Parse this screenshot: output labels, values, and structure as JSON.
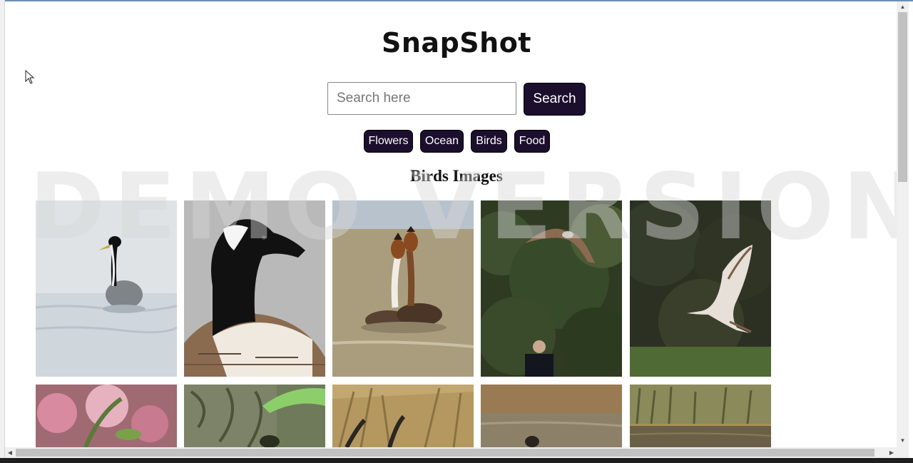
{
  "app": {
    "title": "SnapShot"
  },
  "search": {
    "placeholder": "Search here",
    "value": "",
    "button_label": "Search"
  },
  "categories": [
    "Flowers",
    "Ocean",
    "Birds",
    "Food"
  ],
  "watermark": "DEMO VERSION",
  "section": {
    "title": "Birds Images"
  },
  "images": [
    {
      "name": "grebe-swimming"
    },
    {
      "name": "canada-goose"
    },
    {
      "name": "grebes-pair"
    },
    {
      "name": "kite-over-trees"
    },
    {
      "name": "kite-flying"
    },
    {
      "name": "pink-blossoms"
    },
    {
      "name": "bird-on-bark"
    },
    {
      "name": "bird-in-reeds"
    },
    {
      "name": "bird-on-water"
    },
    {
      "name": "reeds-lake"
    }
  ],
  "colors": {
    "button_bg": "#1c0f2e",
    "button_text": "#ffffff"
  }
}
